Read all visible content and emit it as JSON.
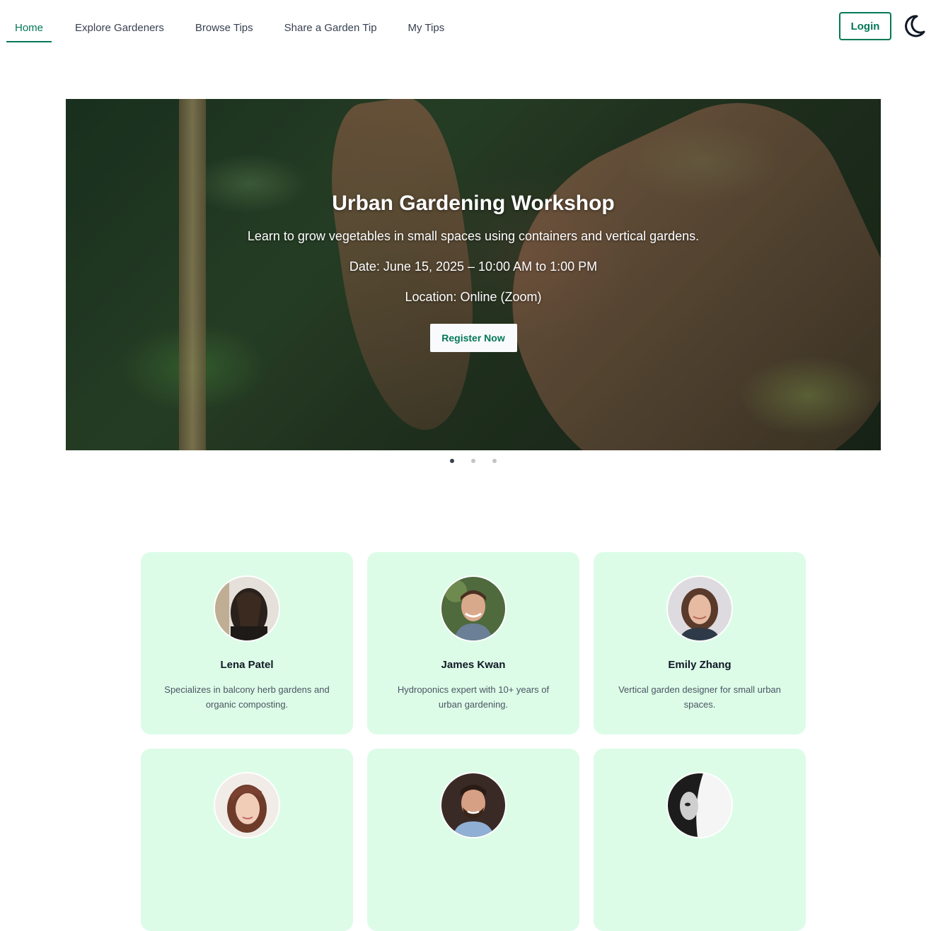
{
  "nav": {
    "links": [
      {
        "label": "Home",
        "active": true
      },
      {
        "label": "Explore Gardeners"
      },
      {
        "label": "Browse Tips"
      },
      {
        "label": "Share a Garden Tip"
      },
      {
        "label": "My Tips"
      }
    ],
    "login_label": "Login",
    "theme_icon": "moon-icon"
  },
  "colors": {
    "accent": "#047857",
    "card_bg": "#dcfce7"
  },
  "hero": {
    "title": "Urban Gardening Workshop",
    "description": "Learn to grow vegetables in small spaces using containers and vertical gardens.",
    "date": "Date: June 15, 2025 – 10:00 AM to 1:00 PM",
    "location": "Location: Online (Zoom)",
    "cta_label": "Register Now",
    "slide_count": 3,
    "active_slide": 1
  },
  "gardeners": [
    {
      "name": "Lena Patel",
      "bio": "Specializes in balcony herb gardens and organic composting."
    },
    {
      "name": "James Kwan",
      "bio": "Hydroponics expert with 10+ years of urban gardening."
    },
    {
      "name": "Emily Zhang",
      "bio": "Vertical garden designer for small urban spaces."
    },
    {
      "name": "",
      "bio": ""
    },
    {
      "name": "",
      "bio": ""
    },
    {
      "name": "",
      "bio": ""
    }
  ]
}
